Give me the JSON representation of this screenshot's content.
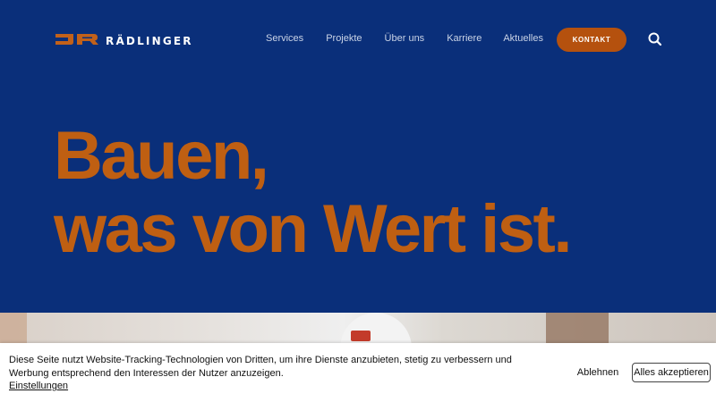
{
  "header": {
    "logo_text": "RÄDLINGER",
    "nav_items": [
      "Services",
      "Projekte",
      "Über uns",
      "Karriere",
      "Aktuelles"
    ],
    "contact_label": "KONTAKT",
    "search_icon": "search-icon"
  },
  "hero": {
    "headline_line1": "Bauen,",
    "headline_line2": "was von Wert ist."
  },
  "cookie_banner": {
    "message": "Diese Seite nutzt Website-Tracking-Technologien von Dritten, um ihre Dienste anzubieten, stetig zu verbessern und Werbung entsprechend den Interessen der Nutzer anzuzeigen.",
    "settings_link": "Einstellungen",
    "decline_label": "Ablehnen",
    "accept_label": "Alles akzeptieren"
  },
  "colors": {
    "background": "#0a2f7a",
    "accent": "#bf5f12",
    "button": "#b5510e"
  }
}
